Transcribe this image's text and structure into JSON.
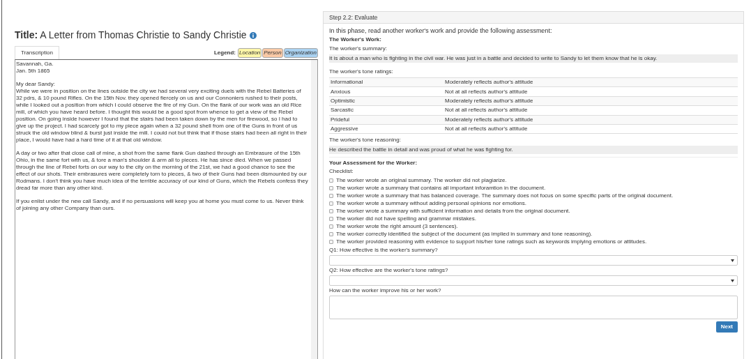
{
  "document": {
    "title_label": "Title:",
    "title": "A Letter from Thomas Christie to Sandy Christie",
    "tabs": [
      {
        "label": "Transcription",
        "selected": true
      }
    ],
    "legend": {
      "label": "Legend:",
      "items": [
        {
          "label": "Location",
          "color": "#fdf6a8"
        },
        {
          "label": "Person",
          "color": "#f9c9a6"
        },
        {
          "label": "Organization",
          "color": "#a9d1f0"
        }
      ]
    },
    "paragraphs": [
      [
        "Savannah, Ga.",
        "Jan. 5th 1865"
      ],
      [
        "My dear Sandy:",
        "While we were in position on the lines outside the city we had several very exciting duels with the Rebel Batteries of 32 pdrs, & 10 pound Rifles. On the 15th Nov. they opened fiercely on us and our Connoniers rushed to their posts, while I looked out a position from which I could observe the fire of my Gun. On the flank of our work was an old Rice mill, of which you have heard before. I thought this would be a good spot from whence to get a view of the Rebel position. On going inside however I found that the stairs had been taken down by the men for firewood, so I had to give up the project. I had scarcely got to my piece again when a 32 pound shell from one of the Guns in front of us struck the old window blind & burst just inside the mill. I could not but think that if those stairs had been all right in their place, I would have had a hard time of it at that old window."
      ],
      [
        "A day or two after that close call of mine, a shot from the same flank Gun dashed through an Embrasure of the 15th Ohio, in the same fort with us, & tore a man's shoulder & arm all to pieces. He has since died. When we passed through the line of Rebel forts on our way to the city on the morning of the 21st, we had a good chance to see the effect of our shots. Their embrasures were completely torn to pieces, & two of their Guns had been dismounted by our Rodmans. I don't think you have much idea of the terrible accuracy of our kind of Guns, which the Rebels confess they dread far more than any other kind."
      ],
      [
        "If you enlist under the new call Sandy, and if no persuasions will keep you at home you must come to us. Never think of joining any other Company than ours."
      ]
    ]
  },
  "panel": {
    "heading": "Step 2.2: Evaluate",
    "intro": "In this phase, read another worker's work and provide the following assessment:",
    "work_heading": "The Worker's Work:",
    "summary_label": "The worker's summary:",
    "summary": "It is about a man who is fighting in the civil war. He was just in a battle and decided to write to Sandy to let them know that he is okay.",
    "ratings_label": "The worker's tone ratings:",
    "ratings": [
      {
        "tone": "Informational",
        "rating": "Moderately reflects author's attitude"
      },
      {
        "tone": "Anxious",
        "rating": "Not at all reflects author's attitude"
      },
      {
        "tone": "Optimistic",
        "rating": "Moderately reflects author's attitude"
      },
      {
        "tone": "Sarcastic",
        "rating": "Not at all reflects author's attitude"
      },
      {
        "tone": "Prideful",
        "rating": "Moderately reflects author's attitude"
      },
      {
        "tone": "Aggressive",
        "rating": "Not at all reflects author's attitude"
      }
    ],
    "reasoning_label": "The worker's tone reasoning:",
    "reasoning": "He described the battle in detail and was proud of what he was fighting for.",
    "assessment_heading": "Your Assessment for the Worker:",
    "checklist_label": "Checklist:",
    "checklist": [
      {
        "label": "The worker wrote an original summary. The worker did not plagiarize.",
        "checked": false
      },
      {
        "label": "The worker wrote a summary that contains all important inforamtion in the document.",
        "checked": false
      },
      {
        "label": "The worker wrote a summary that has balanced coverage. The summary does not focus on some specific parts of the original document.",
        "checked": false
      },
      {
        "label": "The worker wrote a summary without adding personal opinions nor emotions.",
        "checked": false
      },
      {
        "label": "The worker wrote a summary with sufficient information and details from the original document.",
        "checked": false
      },
      {
        "label": "The worker did not have spelling and grammar mistakes.",
        "checked": false
      },
      {
        "label": "The worker wrote the right amount (3 sentences).",
        "checked": false
      },
      {
        "label": "The worker correctly identified the subject of the document (as implied in summary and tone reasoning).",
        "checked": false
      },
      {
        "label": "The worker provided reasoning with evidence to support his/her tone ratings such as keywords implying emotions or attitudes.",
        "checked": false
      }
    ],
    "questions": [
      {
        "kind": "select",
        "label": "Q1: How effective is the worker's summary?"
      },
      {
        "kind": "select",
        "label": "Q2: How effective are the worker's tone ratings?"
      },
      {
        "kind": "textarea",
        "label": "How can the worker improve his or her work?"
      }
    ],
    "next_button": "Next"
  }
}
